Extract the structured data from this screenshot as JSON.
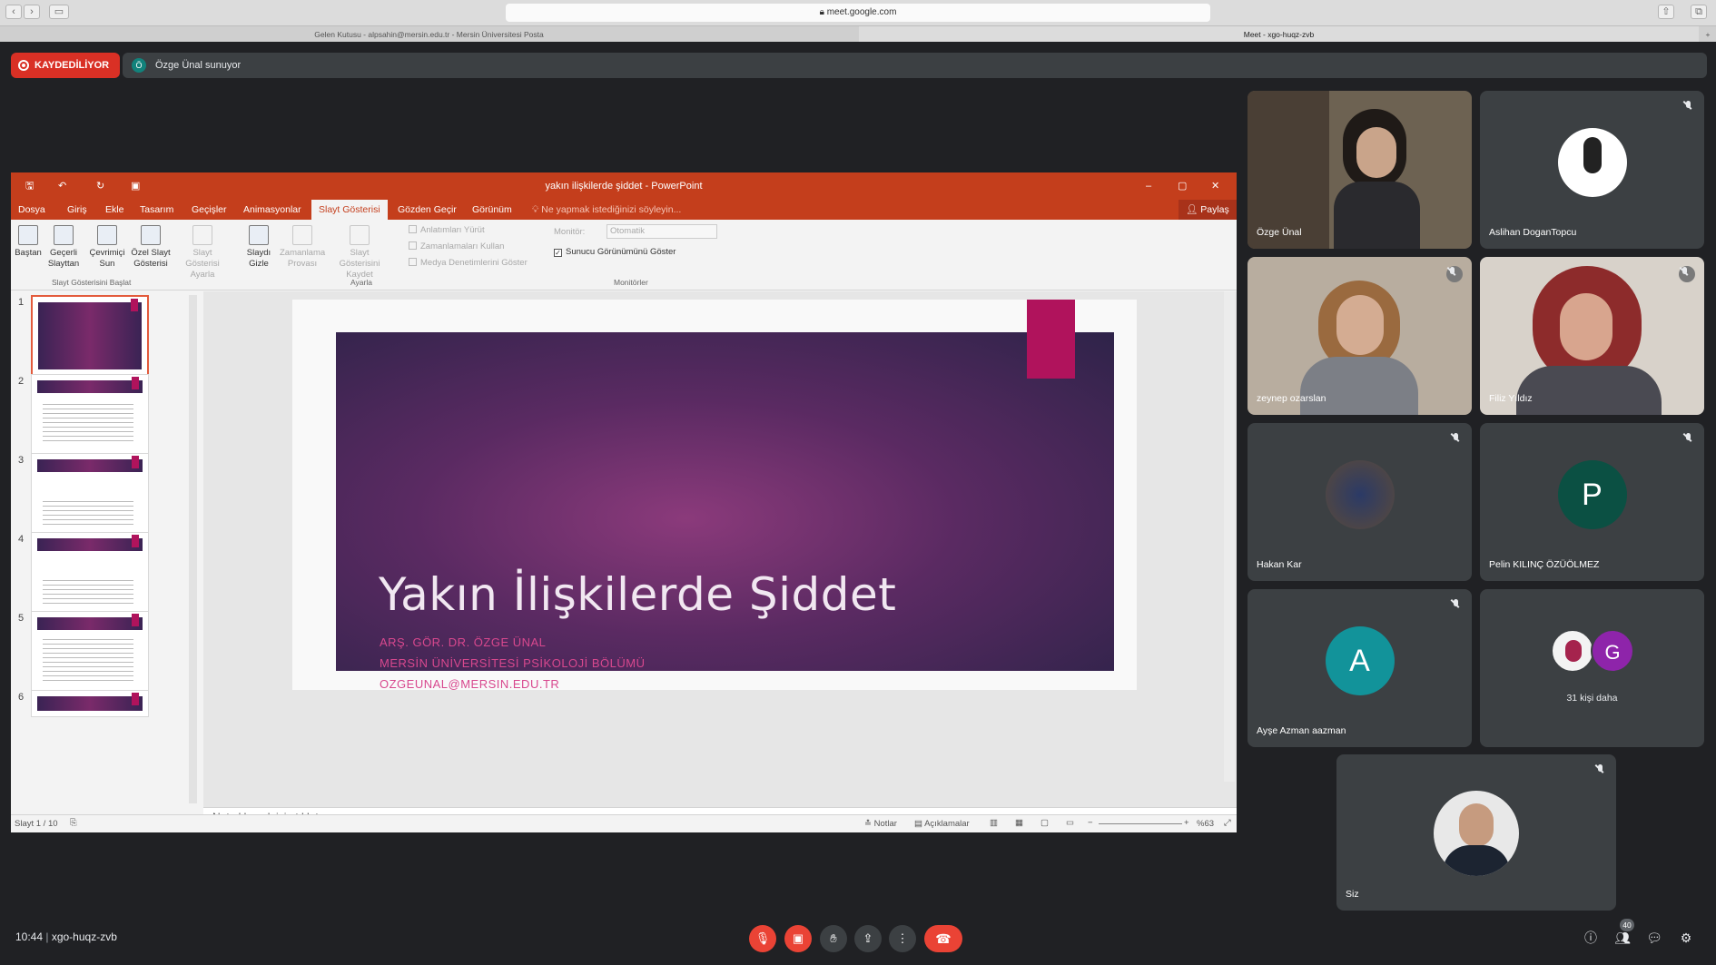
{
  "browser": {
    "url": "meet.google.com",
    "tabs": [
      "Gelen Kutusu - alpsahin@mersin.edu.tr - Mersin Üniversitesi Posta",
      "Meet - xgo-huqz-zvb"
    ]
  },
  "meet": {
    "recording_label": "KAYDEDİLİYOR",
    "presenter_initial": "Ö",
    "presenter_text": "Özge Ünal sunuyor",
    "time": "10:44",
    "meeting_code": "xgo-huqz-zvb",
    "participant_count": "40",
    "colors": {
      "record": "#d93025",
      "end_call": "#ea4335",
      "bg": "#202124",
      "tile": "#3c4043"
    }
  },
  "ppt": {
    "window_title": "yakın ilişkilerde şiddet - PowerPoint",
    "menu": [
      "Dosya",
      "Giriş",
      "Ekle",
      "Tasarım",
      "Geçişler",
      "Animasyonlar",
      "Slayt Gösterisi",
      "Gözden Geçir",
      "Görünüm"
    ],
    "tell_me": "Ne yapmak istediğinizi söyleyin...",
    "share": "Paylaş",
    "ribbon": {
      "baştan": "Baştan",
      "gecerli": "Geçerli Slayttan",
      "cevrimici": "Çevrimiçi Sun",
      "ozel": "Özel Slayt Gösterisi",
      "group1": "Slayt Gösterisini Başlat",
      "ayarla_btn": "Slayt Gösterisi Ayarla",
      "gizle": "Slaydı Gizle",
      "zamanlama": "Zamanlama Provası",
      "kaydet": "Slayt Gösterisini Kaydet",
      "anlatim": "Anlatımları Yürüt",
      "zamanlama_kullan": "Zamanlamaları Kullan",
      "medya": "Medya Denetimlerini Göster",
      "group2": "Ayarla",
      "monitor_label": "Monitör:",
      "monitor_value": "Otomatik",
      "sunucu": "Sunucu Görünümünü Göster",
      "group3": "Monitörler"
    },
    "thumb_numbers": [
      "1",
      "2",
      "3",
      "4",
      "5",
      "6"
    ],
    "slide": {
      "title": "Yakın İlişkilerde Şiddet",
      "line1": "ARŞ. GÖR. DR. ÖZGE ÜNAL",
      "line2": "MERSİN ÜNİVERSİTESİ PSİKOLOJİ BÖLÜMÜ",
      "line3": "OZGEUNAL@MERSIN.EDU.TR"
    },
    "notes_placeholder": "Not eklemek için tıklatın",
    "status": {
      "slide": "Slayt 1 / 10",
      "notes": "Notlar",
      "comments": "Açıklamalar",
      "zoom": "%63"
    }
  },
  "participants": [
    {
      "name": "Özge Ünal"
    },
    {
      "name": "Aslihan DoganTopcu"
    },
    {
      "name": "zeynep ozarslan"
    },
    {
      "name": "Filiz Yıldız"
    },
    {
      "name": "Hakan Kar"
    },
    {
      "name": "Pelin KILINÇ ÖZÜÖLMEZ",
      "initial": "P",
      "color": "#0b5043"
    },
    {
      "name": "Ayşe Azman aazman",
      "initial": "A",
      "color": "#12939a"
    },
    {
      "more": "31 kişi daha",
      "initial": "G",
      "color": "#8e24aa"
    },
    {
      "name": "Siz"
    }
  ]
}
